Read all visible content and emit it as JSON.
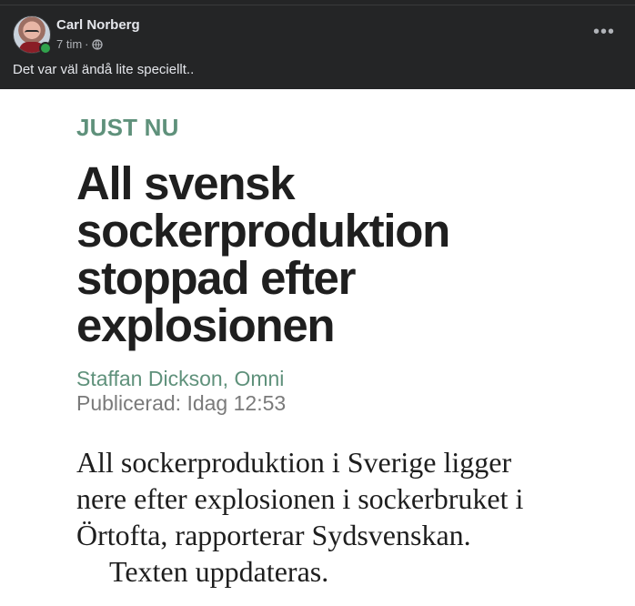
{
  "post": {
    "author_name": "Carl Norberg",
    "time": "7 tim",
    "separator": "·",
    "audience_icon": "globe-icon",
    "more_label": "•••",
    "caption": "Det var väl ändå lite speciellt.."
  },
  "article": {
    "kicker": "JUST NU",
    "headline_lines": [
      "All svensk",
      "sockerproduktion",
      "stoppad efter",
      "explosionen"
    ],
    "author": "Staffan Dickson, Omni",
    "published": "Publicerad: Idag 12:53",
    "body_lines": [
      "All sockerproduktion i Sverige ligger",
      "nere efter explosionen i sockerbruket i",
      "Örtofta, rapporterar Sydsvenskan."
    ],
    "update_note": "Texten uppdateras."
  },
  "colors": {
    "background": "#242526",
    "kicker_green": "#5f917b",
    "online": "#31a24c"
  }
}
